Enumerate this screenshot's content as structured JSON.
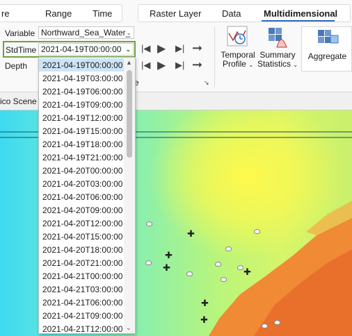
{
  "ribbon": {
    "left_tabs": {
      "cut_label": "re",
      "range_label": "Range",
      "time_label": "Time"
    },
    "right_tabs": {
      "raster_layer_label": "Raster Layer",
      "data_label": "Data",
      "multidimensional_label": "Multidimensional"
    },
    "variable": {
      "label": "Variable",
      "value": "Northward_Sea_Water_"
    },
    "stdtime": {
      "label": "StdTime",
      "value": "2021-04-19T00:00:00"
    },
    "depth": {
      "label": "Depth"
    },
    "buttons": {
      "temporal_profile": [
        "Temporal",
        "Profile"
      ],
      "summary_statistics": [
        "Summary",
        "Statistics"
      ],
      "aggregate": "Aggregate"
    },
    "fragment": "e"
  },
  "scene": {
    "tab_label": "ico Scene"
  },
  "dropdown": {
    "selected": "2021-04-19T00:00:00",
    "items": [
      "2021-04-19T00:00:00",
      "2021-04-19T03:00:00",
      "2021-04-19T06:00:00",
      "2021-04-19T09:00:00",
      "2021-04-19T12:00:00",
      "2021-04-19T15:00:00",
      "2021-04-19T18:00:00",
      "2021-04-19T21:00:00",
      "2021-04-20T00:00:00",
      "2021-04-20T03:00:00",
      "2021-04-20T06:00:00",
      "2021-04-20T09:00:00",
      "2021-04-20T12:00:00",
      "2021-04-20T15:00:00",
      "2021-04-20T18:00:00",
      "2021-04-20T21:00:00",
      "2021-04-21T00:00:00",
      "2021-04-21T03:00:00",
      "2021-04-21T06:00:00",
      "2021-04-21T09:00:00",
      "2021-04-21T12:00:00"
    ]
  },
  "colors": {
    "accent": "#2d6cc0",
    "highlight": "#6ba33a",
    "selected_row": "#cde4f7",
    "map_orange": "#ee7a2a",
    "map_yellow": "#fff94d",
    "map_cyan": "#3fd9f0"
  },
  "icons": [
    "step-back-icon",
    "play-icon",
    "step-forward-icon",
    "arrow-right-icon",
    "temporal-profile-icon",
    "summary-statistics-icon",
    "aggregate-icon",
    "dialog-launcher-icon",
    "chevron-down-icon"
  ]
}
